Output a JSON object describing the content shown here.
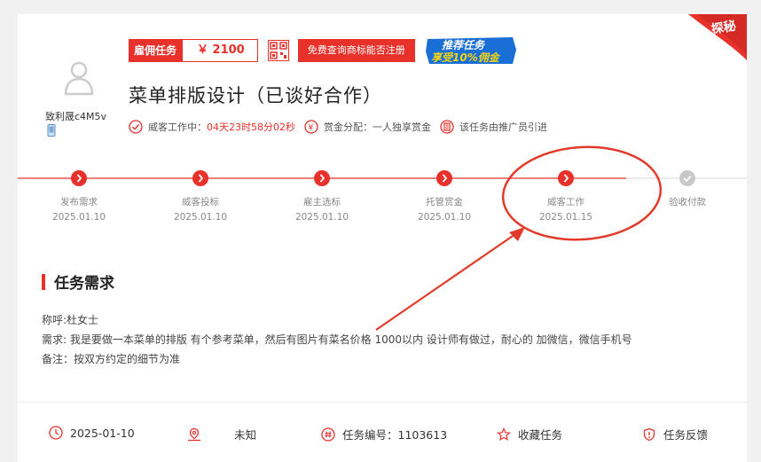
{
  "corner_label": "探秘",
  "user": {
    "name": "致利晟c4M5v"
  },
  "badge": {
    "label": "雇佣任务",
    "price": "￥ 2100"
  },
  "register_button": "免费查询商标能否注册",
  "promo": {
    "line1": "推荐任务",
    "line2": "享受10%佣金"
  },
  "task": {
    "title": "菜单排版设计（已谈好合作）"
  },
  "meta": {
    "status_label": "威客工作中：",
    "countdown": "04天23时58分02秒",
    "reward_label": "赏金分配：一人独享赏金",
    "referral": "该任务由推广员引进"
  },
  "steps": [
    {
      "label": "发布需求",
      "date": "2025.01.10"
    },
    {
      "label": "威客投标",
      "date": "2025.01.10"
    },
    {
      "label": "雇主选标",
      "date": "2025.01.10"
    },
    {
      "label": "托管赏金",
      "date": "2025.01.10"
    },
    {
      "label": "威客工作",
      "date": "2025.01.15"
    },
    {
      "label": "验收付款",
      "date": ""
    }
  ],
  "section": {
    "title": "任务需求"
  },
  "requirements": {
    "contact": "称呼:杜女士",
    "need": "需求: 我是要做一本菜单的排版 有个参考菜单，然后有图片有菜名价格 1000以内  设计师有做过，耐心的  加微信，微信手机号",
    "note": "备注：按双方约定的细节为准"
  },
  "footer": {
    "date": "2025-01-10",
    "location": "未知",
    "task_no": "任务编号：1103613",
    "favorite": "收藏任务",
    "feedback": "任务反馈"
  },
  "colors": {
    "accent": "#e8312a",
    "gray": "#c8c8c8",
    "promo_blue": "#1a6fd6",
    "promo_yellow": "#f6d50e"
  }
}
